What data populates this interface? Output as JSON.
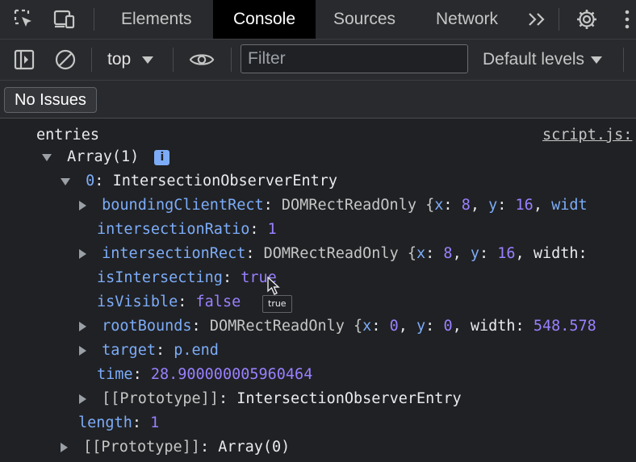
{
  "tabs": {
    "inspect_icon": "inspect-element-icon",
    "device_icon": "device-toolbar-icon",
    "items": [
      "Elements",
      "Console",
      "Sources",
      "Network"
    ],
    "more_label": ">>",
    "settings_icon": "gear-icon",
    "menu_icon": "kebab-menu-icon"
  },
  "toolbar": {
    "context": "top",
    "filter_placeholder": "Filter",
    "levels": "Default levels"
  },
  "issues": {
    "label": "No Issues"
  },
  "console": {
    "source_link": "script.js:",
    "entries_label": "entries",
    "array_label": "Array(1)",
    "info_badge": "i",
    "entry_index": "0",
    "entry_type": "IntersectionObserverEntry",
    "rows": [
      {
        "key": "boundingClientRect",
        "value_type": "DOMRectReadOnly {",
        "x": "8",
        "y": "16",
        "trail": "widt"
      },
      {
        "key": "intersectionRatio",
        "value": "1"
      },
      {
        "key": "intersectionRect",
        "value_type": "DOMRectReadOnly {",
        "x": "8",
        "y": "16",
        "trail": "width:"
      },
      {
        "key": "isIntersecting",
        "value": "true"
      },
      {
        "key": "isVisible",
        "value": "false"
      },
      {
        "key": "rootBounds",
        "value_type": "DOMRectReadOnly {",
        "x": "0",
        "y": "0",
        "width": "548.578"
      },
      {
        "key": "target",
        "value": "p.end"
      },
      {
        "key": "time",
        "value": "28.900000005960464"
      },
      {
        "key": "[[Prototype]]",
        "value": "IntersectionObserverEntry"
      }
    ],
    "length_key": "length",
    "length_value": "1",
    "proto_key": "[[Prototype]]",
    "proto_value": "Array(0)",
    "tooltip": "true"
  },
  "colors": {
    "background": "#202124",
    "toolbar": "#292a2d",
    "key": "#7cacf8",
    "number": "#9980ff"
  }
}
